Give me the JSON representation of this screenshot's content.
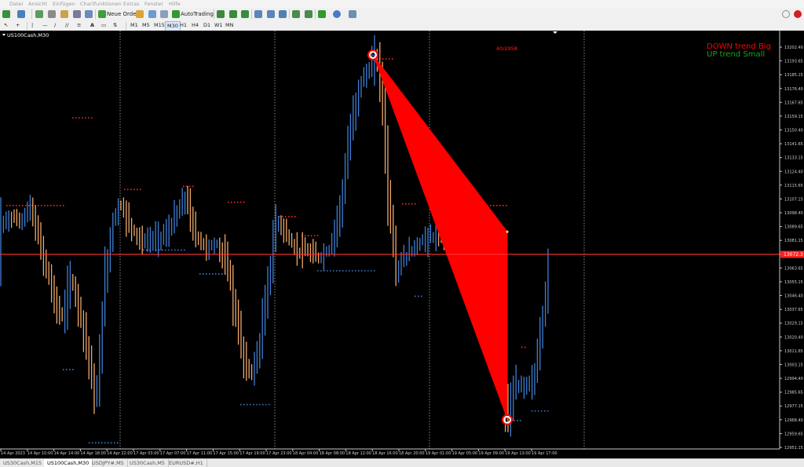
{
  "menu": [
    "Datei",
    "Ansicht",
    "Einfügen",
    "Chartfunktionen",
    "Extras",
    "Fenster",
    "Hilfe"
  ],
  "toolbar": {
    "new_order_label": "Neue Order",
    "autotrading_label": "AutoTrading"
  },
  "timeframes": [
    "M1",
    "M5",
    "M15",
    "M30",
    "H1",
    "H4",
    "D1",
    "W1",
    "MN"
  ],
  "active_timeframe": "M30",
  "chart": {
    "symbol_label": "US100Cash,M30",
    "legend": [
      {
        "text": "DOWN trend Big",
        "color": "#ff0000"
      },
      {
        "text": "UP trend Small",
        "color": "#1fa01f"
      }
    ],
    "pattern_label": "40/2958",
    "current_price_label": "13072.3",
    "price_ticks": [
      "13202.40",
      "13193.65",
      "13185.15",
      "13176.40",
      "13167.65",
      "13159.15",
      "13150.40",
      "13141.65",
      "13133.15",
      "13124.40",
      "13115.65",
      "13107.15",
      "13098.40",
      "13089.65",
      "13081.15",
      "13072.40",
      "13063.65",
      "13055.15",
      "13046.40",
      "13037.65",
      "13029.15",
      "13020.40",
      "13011.65",
      "13003.15",
      "12994.40",
      "12985.65",
      "12977.15",
      "12968.40",
      "12959.65",
      "12951.15"
    ],
    "time_ticks": [
      "14 Apr 2023",
      "14 Apr 10:00",
      "14 Apr 14:00",
      "14 Apr 18:00",
      "14 Apr 22:00",
      "17 Apr 03:00",
      "17 Apr 07:00",
      "17 Apr 11:00",
      "17 Apr 15:00",
      "17 Apr 19:00",
      "17 Apr 23:00",
      "18 Apr 04:00",
      "18 Apr 08:00",
      "18 Apr 12:00",
      "18 Apr 16:00",
      "18 Apr 20:00",
      "19 Apr 01:00",
      "19 Apr 05:00",
      "19 Apr 09:00",
      "19 Apr 13:00",
      "19 Apr 17:00"
    ],
    "colors": {
      "background": "#000000",
      "bull": "#3d7fd6",
      "bear": "#f0a868",
      "pattern": "#ff0000",
      "level_red": "#ff2a2a",
      "level_blue": "#3d7fd6"
    }
  },
  "tabs": [
    {
      "label": "US30Cash,M15",
      "active": false
    },
    {
      "label": "US100Cash,M30",
      "active": true
    },
    {
      "label": "USDJPY#,M5",
      "active": false
    },
    {
      "label": "US30Cash,M5",
      "active": false
    },
    {
      "label": "EURUSD#,H1",
      "active": false
    }
  ]
}
